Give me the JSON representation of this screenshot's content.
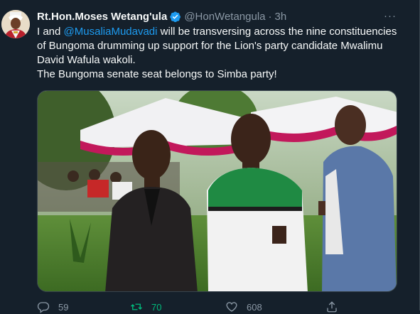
{
  "tweet": {
    "author_name": "Rt.Hon.Moses Wetang'ula",
    "handle": "@HonWetangula",
    "separator": "·",
    "time": "3h",
    "more_label": "···",
    "text_prefix": "I and ",
    "mention": "@MusaliaMudavadi",
    "text_line1_rest": " will be transversing across the nine constituencies of Bungoma drumming up support for the Lion's party candidate Mwalimu David Wafula wakoli.",
    "text_line2": "The Bungoma senate seat belongs to Simba party!",
    "replies": "59",
    "retweets": "70",
    "likes": "608"
  },
  "icons": {
    "verified": "verified-badge-icon",
    "reply": "reply-icon",
    "retweet": "retweet-icon",
    "like": "heart-icon",
    "share": "share-icon",
    "more": "more-icon"
  },
  "colors": {
    "background": "#15202b",
    "accent": "#1d9bf0",
    "retweeted": "#00ba7c",
    "muted": "#8b98a5"
  }
}
